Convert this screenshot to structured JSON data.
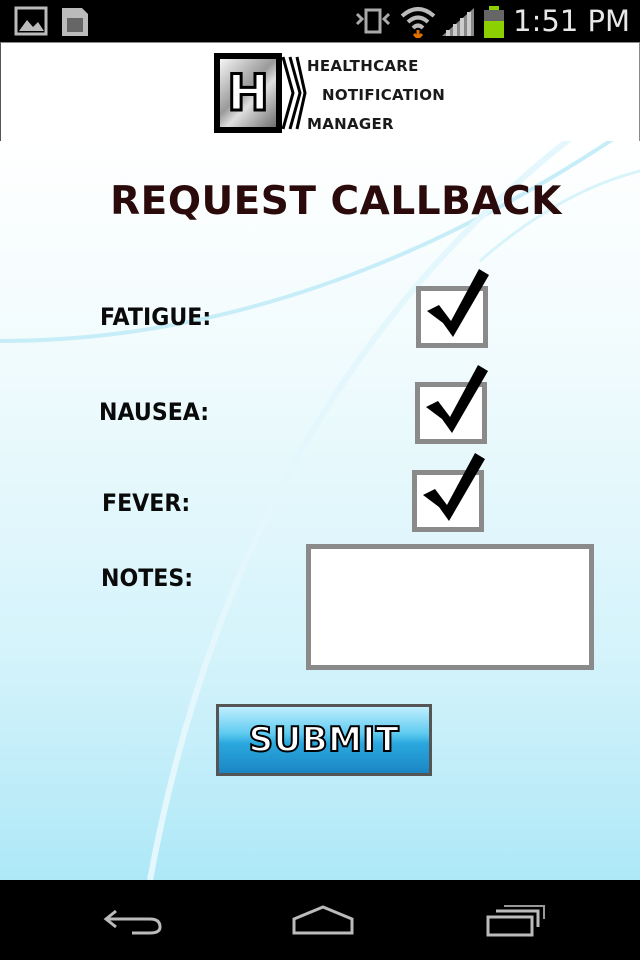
{
  "status_bar": {
    "time": "1:51 PM",
    "icons": [
      "gallery-icon",
      "sd-card-icon",
      "vibrate-icon",
      "wifi-icon",
      "signal-icon",
      "battery-icon"
    ],
    "battery_color": "#8cd000"
  },
  "header": {
    "logo_letter": "H",
    "brand_lines": [
      "HEALTHCARE",
      "NOTIFICATION",
      "MANAGER"
    ]
  },
  "form": {
    "title": "REQUEST CALLBACK",
    "fields": [
      {
        "label": "FATIGUE:",
        "checked": true
      },
      {
        "label": "NAUSEA:",
        "checked": true
      },
      {
        "label": "FEVER:",
        "checked": true
      }
    ],
    "notes_label": "NOTES:",
    "notes_value": "",
    "submit_label": "SUBMIT"
  },
  "nav_bar": {
    "icons": [
      "back-icon",
      "home-icon",
      "recent-apps-icon"
    ]
  },
  "colors": {
    "title": "#2a0a0a",
    "checkbox_border": "#8a8a8a",
    "submit_blue": "#2ba8de",
    "background_cyan": "#aee8f7"
  }
}
